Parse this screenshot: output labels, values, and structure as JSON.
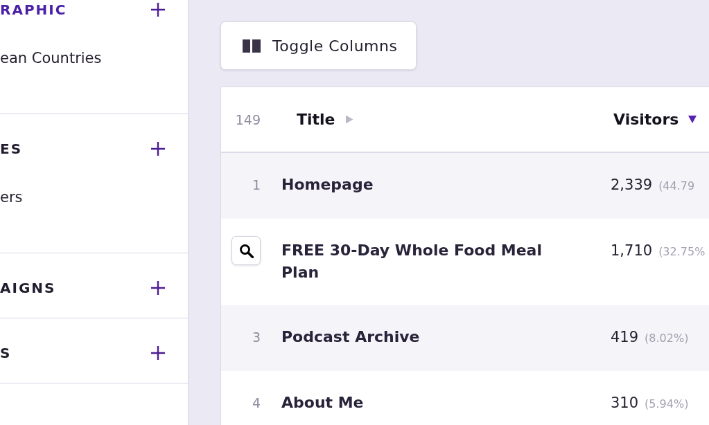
{
  "sidebar": {
    "sections": [
      {
        "heading": "RAPHIC",
        "active": true,
        "items": [
          {
            "label": "ean Countries"
          }
        ]
      },
      {
        "heading": "ES",
        "active": false,
        "items": [
          {
            "label": "ers"
          }
        ]
      },
      {
        "heading": "AIGNS",
        "active": false
      },
      {
        "heading": "S",
        "active": false
      }
    ]
  },
  "toolbar": {
    "toggle_columns_button": "Toggle Columns"
  },
  "table": {
    "count": "149",
    "columns": [
      {
        "label": "Title",
        "sorted": false
      },
      {
        "label": "Visitors",
        "sorted": true
      }
    ],
    "rows": [
      {
        "rank": "1",
        "hovered": false,
        "title": "Homepage",
        "visitors": "2,339",
        "share": "(44.79"
      },
      {
        "hovered": true,
        "title": "FREE 30-Day Whole Food Meal Plan",
        "visitors": "1,710",
        "share": "(32.75%"
      },
      {
        "rank": "3",
        "hovered": false,
        "title": "Podcast Archive",
        "visitors": "419",
        "share": "(8.02%)"
      },
      {
        "rank": "4",
        "hovered": false,
        "title": "About Me",
        "visitors": "310",
        "share": "(5.94%)"
      }
    ]
  }
}
